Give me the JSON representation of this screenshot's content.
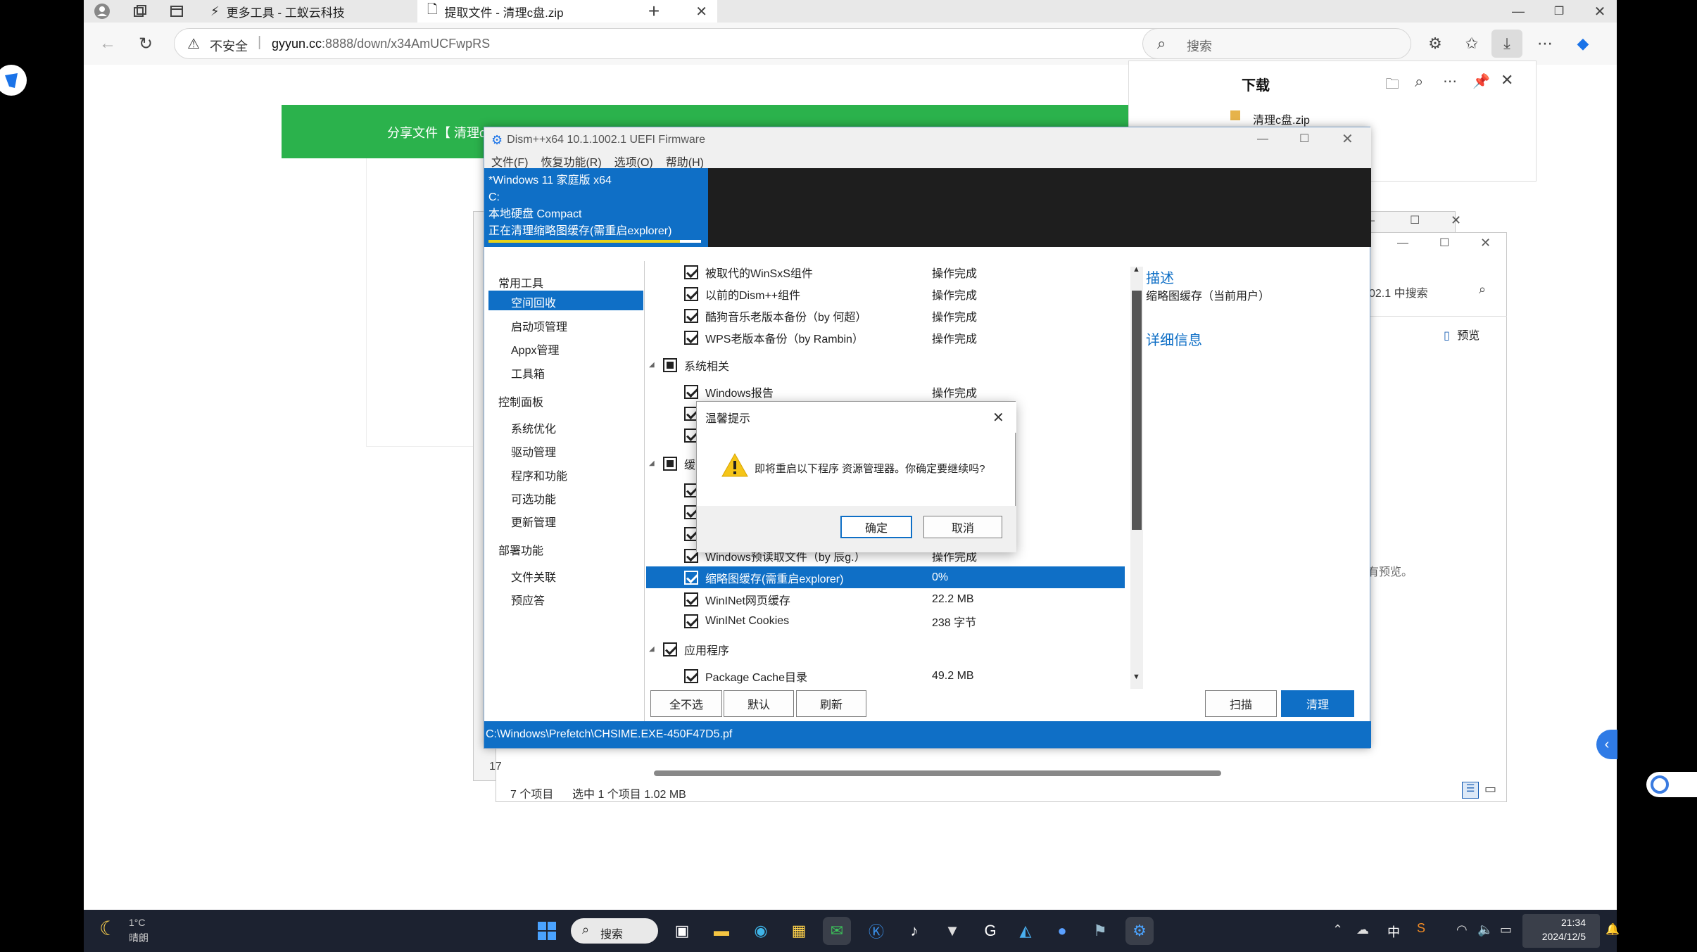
{
  "browser": {
    "tabs": [
      {
        "label": "更多工具 - 工蚁云科技"
      },
      {
        "label": "提取文件 - 清理c盘.zip"
      }
    ],
    "new_tab_icon": "plus-icon",
    "address": {
      "security": "不安全",
      "host": "gyyun.cc",
      "path": ":8888/down/x34AmUCFwpRS"
    },
    "search_placeholder": "搜索"
  },
  "downloads": {
    "title": "下载",
    "file": "清理c盘.zip"
  },
  "page": {
    "banner_text": "分享文件【 清理c"
  },
  "explorer": {
    "search_hint": "02.1 中搜索",
    "preview_label": "预览",
    "no_preview": "有预览。",
    "status_count": "7 个项目",
    "status_selected": "选中 1 个项目  1.02 MB",
    "left_num": "17"
  },
  "dism": {
    "title": "Dism++x64 10.1.1002.1 UEFI Firmware",
    "menu": [
      "文件(F)",
      "恢复功能(R)",
      "选项(O)",
      "帮助(H)"
    ],
    "os": {
      "name": "*Windows 11 家庭版 x64",
      "drive": "C:",
      "disk": "本地硬盘 Compact",
      "task": "正在清理缩略图缓存(需重启explorer)"
    },
    "progress": 0.9,
    "nav": {
      "common": "常用工具",
      "common_items": [
        "空间回收",
        "启动项管理",
        "Appx管理",
        "工具箱"
      ],
      "control": "控制面板",
      "control_items": [
        "系统优化",
        "驱动管理",
        "程序和功能",
        "可选功能",
        "更新管理"
      ],
      "deploy": "部署功能",
      "deploy_items": [
        "文件关联",
        "预应答"
      ]
    },
    "rows": [
      {
        "label": "被取代的WinSxS组件",
        "value": "操作完成"
      },
      {
        "label": "以前的Dism++组件",
        "value": "操作完成"
      },
      {
        "label": "酷狗音乐老版本备份（by 何超）",
        "value": "操作完成"
      },
      {
        "label": "WPS老版本备份（by Rambin）",
        "value": "操作完成"
      },
      {
        "label": "系统相关",
        "value": ""
      },
      {
        "label": "Windows报告",
        "value": "操作完成"
      },
      {
        "label": "缓",
        "value": ""
      },
      {
        "label": "Windows预读取文件（by 辰g.）",
        "value": "操作完成"
      },
      {
        "label": "缩略图缓存(需重启explorer)",
        "value": "0%"
      },
      {
        "label": "WinINet网页缓存",
        "value": "22.2 MB"
      },
      {
        "label": "WinINet Cookies",
        "value": "238 字节"
      },
      {
        "label": "应用程序",
        "value": ""
      },
      {
        "label": "Package Cache目录",
        "value": "49.2 MB"
      }
    ],
    "desc_title": "描述",
    "desc_text": "缩略图缓存（当前用户）",
    "detail_title": "详细信息",
    "buttons": {
      "select_none": "全不选",
      "default": "默认",
      "refresh": "刷新",
      "scan": "扫描",
      "clean": "清理"
    },
    "status": "C:\\Windows\\Prefetch\\CHSIME.EXE-450F47D5.pf"
  },
  "dialog": {
    "title": "温馨提示",
    "message": "即将重启以下程序 资源管理器。你确定要继续吗?",
    "ok": "确定",
    "cancel": "取消"
  },
  "taskbar": {
    "weather_temp": "1°C",
    "weather_desc": "晴朗",
    "search": "搜索",
    "ime": "中",
    "time": "21:34",
    "date": "2024/12/5"
  },
  "colors": {
    "accent": "#0f6fc6",
    "green": "#2bb24c"
  }
}
